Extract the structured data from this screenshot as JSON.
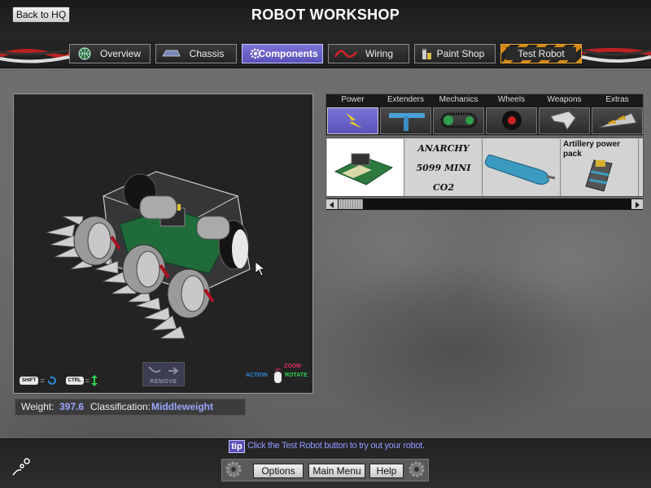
{
  "header": {
    "title": "ROBOT WORKSHOP",
    "back_label": "Back to HQ"
  },
  "tabs": [
    {
      "label": "Overview",
      "icon": "globe-icon"
    },
    {
      "label": "Chassis",
      "icon": "chassis-icon"
    },
    {
      "label": "Components",
      "icon": "gear-icon",
      "active": true
    },
    {
      "label": "Wiring",
      "icon": "wire-icon"
    },
    {
      "label": "Paint Shop",
      "icon": "paint-cans-icon"
    },
    {
      "label": "Test Robot",
      "icon": "hazard-stripes"
    }
  ],
  "viewport": {
    "remove_label": "REMOVE",
    "shift_key": "SHIFT",
    "ctrl_key": "CTRL",
    "eq": "=",
    "action_label": "ACTION",
    "zoom_label": "ZOOM",
    "rotate_label": "ROTATE"
  },
  "status": {
    "weight_label": "Weight:",
    "weight_value": "397.6",
    "class_label": "Classification:",
    "class_value": "Middleweight"
  },
  "categories": [
    {
      "label": "Power",
      "icon": "lightning-icon",
      "active": true
    },
    {
      "label": "Extenders",
      "icon": "t-bar-icon"
    },
    {
      "label": "Mechanics",
      "icon": "chain-drive-icon"
    },
    {
      "label": "Wheels",
      "icon": "wheel-icon"
    },
    {
      "label": "Weapons",
      "icon": "blade-icon"
    },
    {
      "label": "Extras",
      "icon": "wedge-icon"
    }
  ],
  "items": [
    {
      "label": "",
      "icon": "circuit-board-icon",
      "selected": true
    },
    {
      "label": "ANARCHY 5099 MINI CO2",
      "icon": "co2-logo"
    },
    {
      "label": "",
      "icon": "gas-cylinder-icon"
    },
    {
      "label": "Artillery power pack",
      "icon": "power-pack-icon"
    }
  ],
  "tip": {
    "badge": "tip",
    "text": "Click the Test Robot button to try out your robot."
  },
  "menu": {
    "options": "Options",
    "main_menu": "Main Menu",
    "help": "Help"
  },
  "colors": {
    "accent": "#5a52b8",
    "accent_light": "#9aa7ff",
    "hazard": "#d48a14",
    "cable_red": "#c0392b"
  }
}
